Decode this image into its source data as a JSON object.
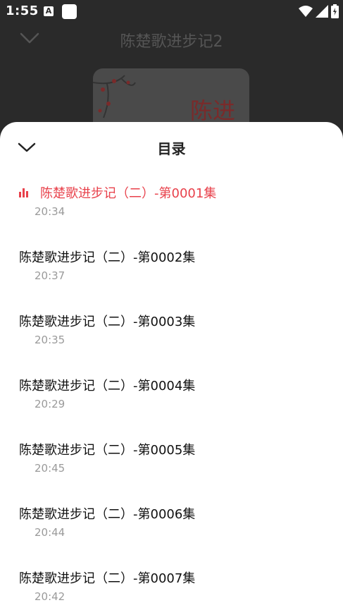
{
  "status": {
    "time": "1:55",
    "a_icon": "A"
  },
  "player": {
    "title": "陈楚歌进步记2",
    "cover_text": "陈进"
  },
  "sheet": {
    "title": "目录"
  },
  "episodes": [
    {
      "title": "陈楚歌进步记（二）-第0001集",
      "duration": "20:34",
      "active": true
    },
    {
      "title": "陈楚歌进步记（二）-第0002集",
      "duration": "20:37"
    },
    {
      "title": "陈楚歌进步记（二）-第0003集",
      "duration": "20:35"
    },
    {
      "title": "陈楚歌进步记（二）-第0004集",
      "duration": "20:29"
    },
    {
      "title": "陈楚歌进步记（二）-第0005集",
      "duration": "20:45"
    },
    {
      "title": "陈楚歌进步记（二）-第0006集",
      "duration": "20:44"
    },
    {
      "title": "陈楚歌进步记（二）-第0007集",
      "duration": "20:42"
    }
  ],
  "colors": {
    "accent": "#e8414b",
    "muted": "#9a9a9a",
    "text": "#111111"
  }
}
